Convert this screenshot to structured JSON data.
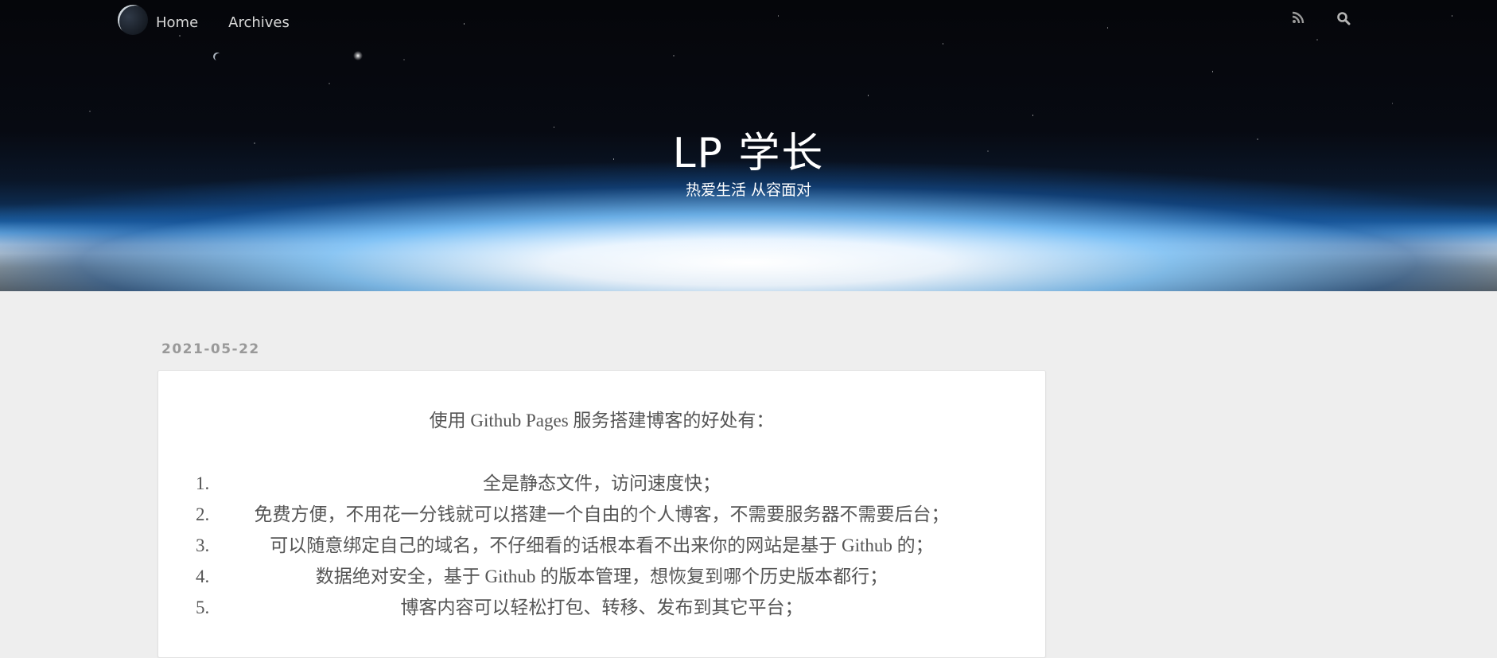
{
  "nav": {
    "items": [
      {
        "label": "Home"
      },
      {
        "label": "Archives"
      }
    ]
  },
  "site": {
    "title": "LP 学长",
    "subtitle": "热爱生活 从容面对"
  },
  "icons": {
    "rss": "rss-icon",
    "search": "search-icon"
  },
  "post": {
    "date": "2021-05-22",
    "intro": "使用 Github Pages 服务搭建博客的好处有：",
    "list": [
      {
        "num": "1.",
        "text": "全是静态文件，访问速度快；"
      },
      {
        "num": "2.",
        "text": "免费方便，不用花一分钱就可以搭建一个自由的个人博客，不需要服务器不需要后台；"
      },
      {
        "num": "3.",
        "text": "可以随意绑定自己的域名，不仔细看的话根本看不出来你的网站是基于 Github 的；"
      },
      {
        "num": "4.",
        "text": "数据绝对安全，基于 Github 的版本管理，想恢复到哪个历史版本都行；"
      },
      {
        "num": "5.",
        "text": "博客内容可以轻松打包、转移、发布到其它平台；"
      }
    ]
  }
}
